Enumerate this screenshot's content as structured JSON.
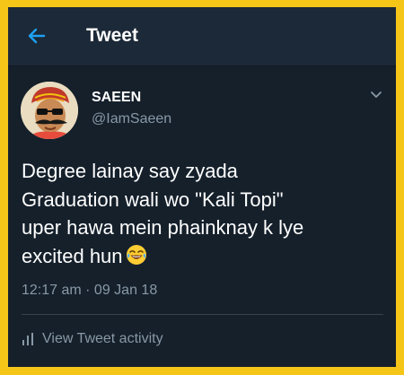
{
  "header": {
    "title": "Tweet",
    "back_icon": "back-arrow-icon",
    "accent_color": "#1da1f2"
  },
  "tweet": {
    "author_name": "SAEEN",
    "author_handle": "@IamSaeen",
    "lines": [
      "Degree lainay say zyada",
      "Graduation wali wo \"Kali Topi\"",
      "uper hawa mein phainknay k lye",
      "excited hun"
    ],
    "emoji": "laughing-emoji",
    "timestamp": "12:17 am · 09 Jan 18",
    "menu_icon": "chevron-down-icon"
  },
  "footer": {
    "activity_label": "View Tweet activity",
    "activity_icon": "bar-chart-icon"
  },
  "colors": {
    "border": "#f5c518",
    "background": "#15202b",
    "header_bg": "#1c2938",
    "text_primary": "#ffffff",
    "text_secondary": "#8899a6"
  }
}
